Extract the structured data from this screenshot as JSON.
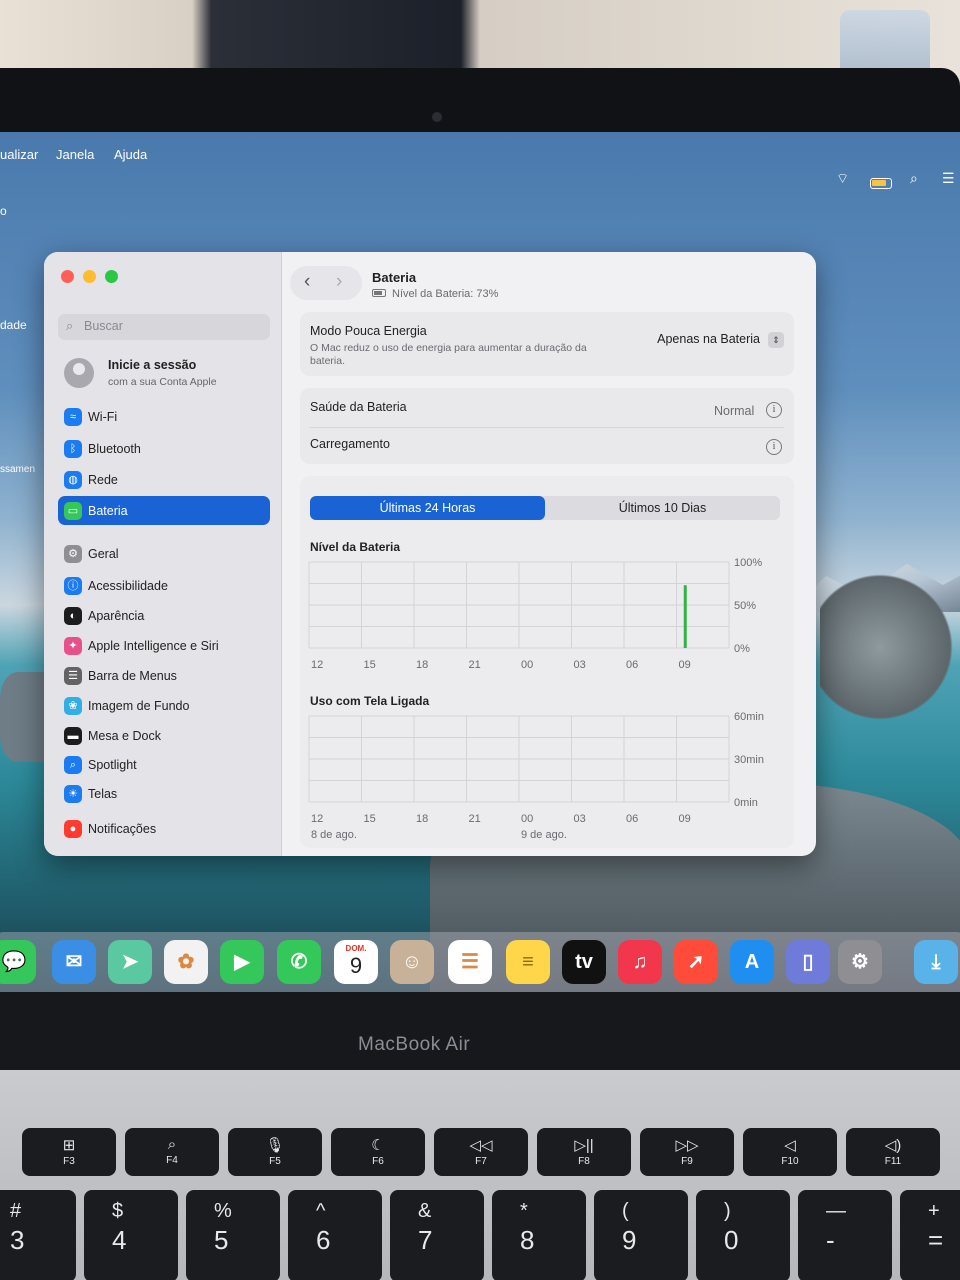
{
  "menubar": {
    "items": [
      "ualizar",
      "Janela",
      "Ajuda"
    ]
  },
  "status_icons": [
    "wifi-icon",
    "battery-icon",
    "search-icon",
    "control-center-icon"
  ],
  "edge_text": {
    "o": "o",
    "dade": "dade",
    "ssamen": "ssamen"
  },
  "window": {
    "sidebar": {
      "search_placeholder": "Buscar",
      "account": {
        "title": "Inicie a sessão",
        "subtitle": "com a sua Conta Apple"
      },
      "items": [
        {
          "label": "Wi-Fi",
          "icon": "wifi-icon",
          "color": "#1a7cf0"
        },
        {
          "label": "Bluetooth",
          "icon": "bluetooth-icon",
          "color": "#1a7cf0"
        },
        {
          "label": "Rede",
          "icon": "globe-icon",
          "color": "#1a7cf0"
        },
        {
          "label": "Bateria",
          "icon": "battery-icon",
          "color": "#34c759",
          "active": true
        },
        {
          "label": "Geral",
          "icon": "gear-icon",
          "color": "#8e8e93"
        },
        {
          "label": "Acessibilidade",
          "icon": "accessibility-icon",
          "color": "#1a7cf0"
        },
        {
          "label": "Aparência",
          "icon": "appearance-icon",
          "color": "#1c1c1e"
        },
        {
          "label": "Apple Intelligence e Siri",
          "icon": "siri-icon",
          "color": "#e8508a"
        },
        {
          "label": "Barra de Menus",
          "icon": "menubar-icon",
          "color": "#636366"
        },
        {
          "label": "Imagem de Fundo",
          "icon": "wallpaper-icon",
          "color": "#32ade6"
        },
        {
          "label": "Mesa e Dock",
          "icon": "dock-icon",
          "color": "#1c1c1e"
        },
        {
          "label": "Spotlight",
          "icon": "spotlight-icon",
          "color": "#1a7cf0"
        },
        {
          "label": "Telas",
          "icon": "display-icon",
          "color": "#1a7cf0"
        },
        {
          "label": "Notificações",
          "icon": "notifications-icon",
          "color": "#ff3b30"
        }
      ]
    },
    "main": {
      "title": "Bateria",
      "subtitle": "Nível da Bateria: 73%",
      "low_power": {
        "title": "Modo Pouca Energia",
        "description": "O Mac reduz o uso de energia para aumentar a duração da bateria.",
        "value": "Apenas na Bateria"
      },
      "health": {
        "title": "Saúde da Bateria",
        "value": "Normal"
      },
      "charging": {
        "title": "Carregamento"
      },
      "tabs": [
        "Últimas 24 Horas",
        "Últimos 10 Dias"
      ],
      "selected_tab": 0
    }
  },
  "chart_data": [
    {
      "type": "bar",
      "title": "Nível da Bateria",
      "x_tick_labels": [
        "12",
        "15",
        "18",
        "21",
        "00",
        "03",
        "06",
        "09"
      ],
      "y_tick_labels": [
        "100%",
        "50%",
        "0%"
      ],
      "ylim": [
        0,
        100
      ],
      "bars": [
        {
          "time": "09:30",
          "value": 73,
          "color": "#2fb344"
        }
      ],
      "grid": true
    },
    {
      "type": "bar",
      "title": "Uso com Tela Ligada",
      "x_tick_labels": [
        "12",
        "15",
        "18",
        "21",
        "00",
        "03",
        "06",
        "09"
      ],
      "date_labels": [
        "8 de ago.",
        "9 de ago."
      ],
      "y_tick_labels": [
        "60min",
        "30min",
        "0min"
      ],
      "ylim": [
        0,
        60
      ],
      "bars": [],
      "grid": true
    }
  ],
  "dock": {
    "calendar": {
      "month": "DOM.",
      "day": "9"
    },
    "apps": [
      {
        "name": "messages-icon",
        "color": "#34c759"
      },
      {
        "name": "mail-icon",
        "color": "#3a8ee6"
      },
      {
        "name": "maps-icon",
        "color": "#5ac8a0"
      },
      {
        "name": "photos-icon",
        "color": "#f2f2f2"
      },
      {
        "name": "facetime-icon",
        "color": "#34c759"
      },
      {
        "name": "phone-icon",
        "color": "#34c759"
      },
      {
        "name": "calendar-icon",
        "color": "#ffffff"
      },
      {
        "name": "contacts-icon",
        "color": "#c7b299"
      },
      {
        "name": "reminders-icon",
        "color": "#ffffff"
      },
      {
        "name": "notes-icon",
        "color": "#ffd54a"
      },
      {
        "name": "apple-tv-icon",
        "color": "#111111"
      },
      {
        "name": "music-icon",
        "color": "#f2374d"
      },
      {
        "name": "rocket-icon",
        "color": "#ff4b3a"
      },
      {
        "name": "app-store-icon",
        "color": "#1f8ef1"
      },
      {
        "name": "iphone-mirroring-icon",
        "color": "#6e7bd9"
      },
      {
        "name": "system-settings-icon",
        "color": "#8e8e93"
      },
      {
        "name": "downloads-folder-icon",
        "color": "#5ab3e8"
      }
    ]
  },
  "laptop": {
    "brand": "MacBook Air"
  },
  "keyboard": {
    "fn_row": [
      {
        "glyph": "⊞",
        "label": "F3"
      },
      {
        "glyph": "⌕",
        "label": "F4"
      },
      {
        "glyph": "🎙",
        "label": "F5"
      },
      {
        "glyph": "☾",
        "label": "F6"
      },
      {
        "glyph": "◁◁",
        "label": "F7"
      },
      {
        "glyph": "▷||",
        "label": "F8"
      },
      {
        "glyph": "▷▷",
        "label": "F9"
      },
      {
        "glyph": "◁",
        "label": "F10"
      },
      {
        "glyph": "◁)",
        "label": "F11"
      }
    ],
    "number_row": [
      {
        "top": "#",
        "bottom": "3"
      },
      {
        "top": "$",
        "bottom": "4"
      },
      {
        "top": "%",
        "bottom": "5"
      },
      {
        "top": "^",
        "bottom": "6"
      },
      {
        "top": "&",
        "bottom": "7"
      },
      {
        "top": "*",
        "bottom": "8"
      },
      {
        "top": "(",
        "bottom": "9"
      },
      {
        "top": ")",
        "bottom": "0"
      },
      {
        "top": "—",
        "bottom": "-"
      },
      {
        "top": "+",
        "bottom": "="
      }
    ]
  }
}
